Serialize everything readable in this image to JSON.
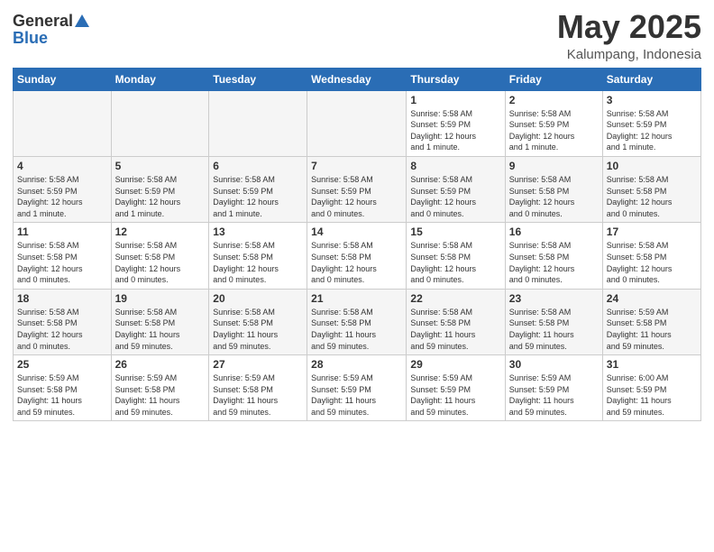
{
  "logo": {
    "general": "General",
    "blue": "Blue"
  },
  "header": {
    "month": "May 2025",
    "location": "Kalumpang, Indonesia"
  },
  "days_of_week": [
    "Sunday",
    "Monday",
    "Tuesday",
    "Wednesday",
    "Thursday",
    "Friday",
    "Saturday"
  ],
  "weeks": [
    [
      {
        "day": "",
        "info": ""
      },
      {
        "day": "",
        "info": ""
      },
      {
        "day": "",
        "info": ""
      },
      {
        "day": "",
        "info": ""
      },
      {
        "day": "1",
        "info": "Sunrise: 5:58 AM\nSunset: 5:59 PM\nDaylight: 12 hours\nand 1 minute."
      },
      {
        "day": "2",
        "info": "Sunrise: 5:58 AM\nSunset: 5:59 PM\nDaylight: 12 hours\nand 1 minute."
      },
      {
        "day": "3",
        "info": "Sunrise: 5:58 AM\nSunset: 5:59 PM\nDaylight: 12 hours\nand 1 minute."
      }
    ],
    [
      {
        "day": "4",
        "info": "Sunrise: 5:58 AM\nSunset: 5:59 PM\nDaylight: 12 hours\nand 1 minute."
      },
      {
        "day": "5",
        "info": "Sunrise: 5:58 AM\nSunset: 5:59 PM\nDaylight: 12 hours\nand 1 minute."
      },
      {
        "day": "6",
        "info": "Sunrise: 5:58 AM\nSunset: 5:59 PM\nDaylight: 12 hours\nand 1 minute."
      },
      {
        "day": "7",
        "info": "Sunrise: 5:58 AM\nSunset: 5:59 PM\nDaylight: 12 hours\nand 0 minutes."
      },
      {
        "day": "8",
        "info": "Sunrise: 5:58 AM\nSunset: 5:59 PM\nDaylight: 12 hours\nand 0 minutes."
      },
      {
        "day": "9",
        "info": "Sunrise: 5:58 AM\nSunset: 5:58 PM\nDaylight: 12 hours\nand 0 minutes."
      },
      {
        "day": "10",
        "info": "Sunrise: 5:58 AM\nSunset: 5:58 PM\nDaylight: 12 hours\nand 0 minutes."
      }
    ],
    [
      {
        "day": "11",
        "info": "Sunrise: 5:58 AM\nSunset: 5:58 PM\nDaylight: 12 hours\nand 0 minutes."
      },
      {
        "day": "12",
        "info": "Sunrise: 5:58 AM\nSunset: 5:58 PM\nDaylight: 12 hours\nand 0 minutes."
      },
      {
        "day": "13",
        "info": "Sunrise: 5:58 AM\nSunset: 5:58 PM\nDaylight: 12 hours\nand 0 minutes."
      },
      {
        "day": "14",
        "info": "Sunrise: 5:58 AM\nSunset: 5:58 PM\nDaylight: 12 hours\nand 0 minutes."
      },
      {
        "day": "15",
        "info": "Sunrise: 5:58 AM\nSunset: 5:58 PM\nDaylight: 12 hours\nand 0 minutes."
      },
      {
        "day": "16",
        "info": "Sunrise: 5:58 AM\nSunset: 5:58 PM\nDaylight: 12 hours\nand 0 minutes."
      },
      {
        "day": "17",
        "info": "Sunrise: 5:58 AM\nSunset: 5:58 PM\nDaylight: 12 hours\nand 0 minutes."
      }
    ],
    [
      {
        "day": "18",
        "info": "Sunrise: 5:58 AM\nSunset: 5:58 PM\nDaylight: 12 hours\nand 0 minutes."
      },
      {
        "day": "19",
        "info": "Sunrise: 5:58 AM\nSunset: 5:58 PM\nDaylight: 11 hours\nand 59 minutes."
      },
      {
        "day": "20",
        "info": "Sunrise: 5:58 AM\nSunset: 5:58 PM\nDaylight: 11 hours\nand 59 minutes."
      },
      {
        "day": "21",
        "info": "Sunrise: 5:58 AM\nSunset: 5:58 PM\nDaylight: 11 hours\nand 59 minutes."
      },
      {
        "day": "22",
        "info": "Sunrise: 5:58 AM\nSunset: 5:58 PM\nDaylight: 11 hours\nand 59 minutes."
      },
      {
        "day": "23",
        "info": "Sunrise: 5:58 AM\nSunset: 5:58 PM\nDaylight: 11 hours\nand 59 minutes."
      },
      {
        "day": "24",
        "info": "Sunrise: 5:59 AM\nSunset: 5:58 PM\nDaylight: 11 hours\nand 59 minutes."
      }
    ],
    [
      {
        "day": "25",
        "info": "Sunrise: 5:59 AM\nSunset: 5:58 PM\nDaylight: 11 hours\nand 59 minutes."
      },
      {
        "day": "26",
        "info": "Sunrise: 5:59 AM\nSunset: 5:58 PM\nDaylight: 11 hours\nand 59 minutes."
      },
      {
        "day": "27",
        "info": "Sunrise: 5:59 AM\nSunset: 5:58 PM\nDaylight: 11 hours\nand 59 minutes."
      },
      {
        "day": "28",
        "info": "Sunrise: 5:59 AM\nSunset: 5:59 PM\nDaylight: 11 hours\nand 59 minutes."
      },
      {
        "day": "29",
        "info": "Sunrise: 5:59 AM\nSunset: 5:59 PM\nDaylight: 11 hours\nand 59 minutes."
      },
      {
        "day": "30",
        "info": "Sunrise: 5:59 AM\nSunset: 5:59 PM\nDaylight: 11 hours\nand 59 minutes."
      },
      {
        "day": "31",
        "info": "Sunrise: 6:00 AM\nSunset: 5:59 PM\nDaylight: 11 hours\nand 59 minutes."
      }
    ]
  ]
}
